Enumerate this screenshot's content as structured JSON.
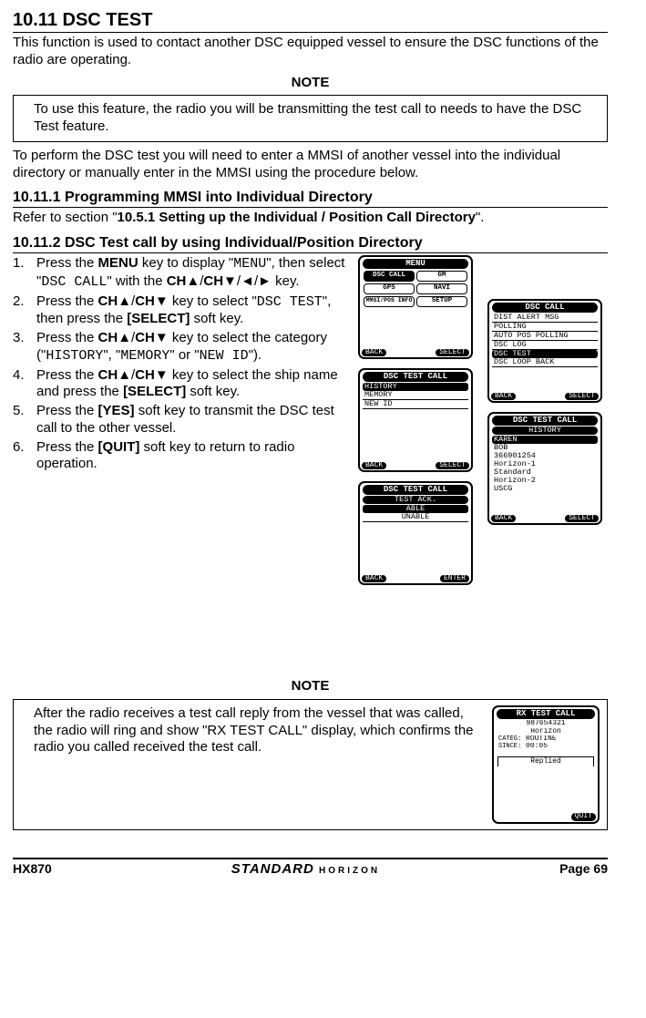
{
  "section": {
    "number": "10.11",
    "title": "DSC TEST",
    "intro": "This function is used to contact another DSC equipped vessel to ensure the DSC functions of the radio are operating."
  },
  "note1": {
    "label": "NOTE",
    "text": "To use this feature, the radio you will be transmitting the test call to needs to have the DSC Test feature."
  },
  "para_after_note1": "To perform the DSC test you will need to enter a MMSI of another vessel into the individual directory or manually enter in the MMSI using the procedure below.",
  "sub1": {
    "num": "10.11.1",
    "title": "Programming MMSI into Individual Directory",
    "text_prefix": "Refer to section \"",
    "text_ref": "10.5.1  Setting up the Individual / Position Call Directory",
    "text_suffix": "\"."
  },
  "sub2": {
    "num": "10.11.2",
    "title": "DSC Test call by using Individual/Position Directory"
  },
  "steps": [
    {
      "n": "1.",
      "html": "Press the <b>MENU</b> key to display \"<span class='code'>MENU</span>\", then select \"<span class='code'>DSC CALL</span>\" with the <b>CH▲</b>/<b>CH▼</b>/<b>◄</b>/<b>►</b> key."
    },
    {
      "n": "2.",
      "html": "Press the <b>CH▲</b>/<b>CH▼</b> key to select \"<span class='code'>DSC TEST</span>\", then press the <b>[SELECT]</b> soft key."
    },
    {
      "n": "3.",
      "html": "Press the <b>CH▲</b>/<b>CH▼</b> key to select the category (\"<span class='code'>HISTORY</span>\", \"<span class='code'>MEMORY</span>\" or \"<span class='code'>NEW ID</span>\")."
    },
    {
      "n": "4.",
      "html": "Press the <b>CH▲</b>/<b>CH▼</b> key to select the ship name and press the <b>[SELECT]</b> soft key."
    },
    {
      "n": "5.",
      "html": "Press the <b>[YES]</b> soft key to transmit the DSC test call to the other vessel."
    },
    {
      "n": "6.",
      "html": "Press the <b>[QUIT]</b> soft key to return to radio operation."
    }
  ],
  "lcd_menu": {
    "title": "MENU",
    "cells": [
      "DSC CALL",
      "GM",
      "GPS",
      "NAVI",
      "MMSI/POS INFO",
      "SETUP"
    ],
    "soft_left": "BACK",
    "soft_right": "SELECT"
  },
  "lcd_dsc_call": {
    "title": "DSC CALL",
    "items": [
      "DIST ALERT MSG",
      "POLLING",
      "AUTO POS POLLING",
      "DSC LOG",
      "DSC TEST",
      "DSC LOOP BACK"
    ],
    "selected": "DSC TEST",
    "soft_left": "BACK",
    "soft_right": "SELECT"
  },
  "lcd_ctest": {
    "title": "DSC TEST CALL",
    "items": [
      "HISTORY",
      "MEMORY",
      "NEW ID"
    ],
    "selected": "HISTORY",
    "soft_left": "BACK",
    "soft_right": "SELECT"
  },
  "lcd_history": {
    "title": "DSC TEST CALL",
    "sub": "HISTORY",
    "items": [
      "KAREN",
      "BOB",
      "366901254",
      "Horizon-1",
      "Standard",
      "Horizon-2",
      "USCG"
    ],
    "selected": "KAREN",
    "soft_left": "BACK",
    "soft_right": "SELECT"
  },
  "lcd_ack": {
    "title": "DSC TEST CALL",
    "sub": "TEST ACK.",
    "items": [
      "ABLE",
      "UNABLE"
    ],
    "selected": "ABLE",
    "soft_left": "BACK",
    "soft_right": "ENTER"
  },
  "note2": {
    "label": "NOTE",
    "text": "After the radio receives a test call reply from the vessel that was called, the radio will ring and show \"RX TEST CALL\" display, which confirms the radio you called received the test call."
  },
  "lcd_rx": {
    "title": "RX TEST CALL",
    "mmsi": "987654321",
    "name": "Horizon",
    "categ_label": "CATEG:",
    "categ": "ROUTINE",
    "since_label": "SINCE:",
    "since": "00:05",
    "replied": "Replied",
    "soft_right": "QUIT"
  },
  "footer": {
    "model": "HX870",
    "brand_top": "STANDARD",
    "brand_bottom": "HORIZON",
    "page": "Page 69"
  }
}
